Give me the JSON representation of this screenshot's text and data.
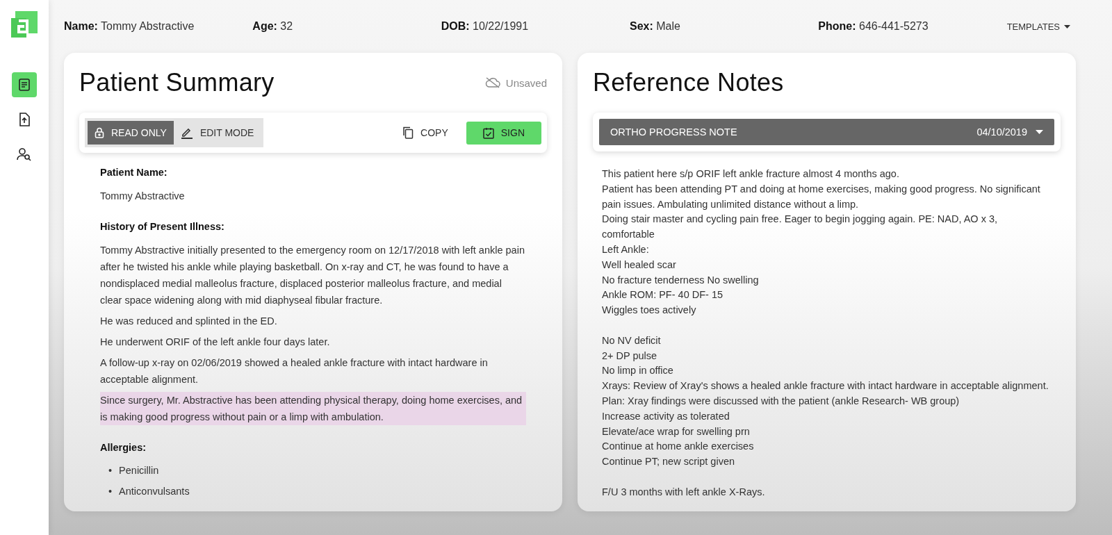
{
  "sidebar": {
    "items": [
      {
        "kind": "document",
        "selected": true
      },
      {
        "kind": "upload",
        "selected": false
      },
      {
        "kind": "user-search",
        "selected": false
      }
    ]
  },
  "header": {
    "fields": [
      "**Name:** Tommy Abstractive",
      "**Age:** 32",
      "**DOB:** 10/22/1991",
      "**Sex:** Male",
      "**Phone:** 646-441-5273"
    ],
    "templates_button": "TEMPLATES"
  },
  "patient_summary": {
    "title": "Patient Summary",
    "save_status": "Unsaved",
    "modes": [
      {
        "label": "READ ONLY",
        "kind": "lock",
        "selected": true
      },
      {
        "label": "EDIT MODE",
        "kind": "pen",
        "selected": false
      }
    ],
    "copy_button": "COPY",
    "sign_button": "SIGN",
    "sections": [
      {
        "heading": "Patient Name:",
        "paragraphs": [
          {
            "text": "Tommy Abstractive",
            "highlighted": false
          }
        ]
      },
      {
        "heading": "History of Present Illness:",
        "paragraphs": [
          {
            "text": "Tommy Abstractive initially presented to the emergency room on 12/17/2018 with left ankle pain after he twisted his ankle while playing basketball. On x-ray and CT, he was found to have a nondisplaced medial malleolus fracture, displaced posterior malleolus fracture, and medial clear space widening along with mid diaphyseal fibular fracture.",
            "highlighted": false
          },
          {
            "text": "He was reduced and splinted in the ED.",
            "highlighted": false
          },
          {
            "text": "He underwent ORIF of the left ankle four days later.",
            "highlighted": false
          },
          {
            "text": "A follow-up x-ray on 02/06/2019 showed a healed ankle fracture with intact hardware in acceptable alignment.",
            "highlighted": false
          },
          {
            "text": "Since surgery, Mr. Abstractive has been attending physical therapy, doing home exercises, and is making good progress without pain or a limp with ambulation.",
            "highlighted": true
          }
        ]
      },
      {
        "heading": "Allergies:",
        "bullets": [
          {
            "marker": "•",
            "text": "Penicillin"
          },
          {
            "marker": "•",
            "text": "Anticonvulsants"
          }
        ]
      }
    ]
  },
  "reference_notes": {
    "title": "Reference Notes",
    "note_select": {
      "label": "ORTHO PROGRESS NOTE",
      "date": "04/10/2019"
    },
    "groups": [
      {
        "lines": [
          "This patient here s/p ORIF left ankle fracture almost 4 months ago.",
          "Patient has been attending PT and doing at home exercises, making good progress. No significant pain issues. Ambulating unlimited distance without a limp.",
          "Doing stair master and cycling pain free. Eager to begin jogging again. PE: NAD, AO x 3, comfortable",
          "Left Ankle:",
          "Well healed scar",
          "No fracture tenderness No swelling",
          "Ankle ROM: PF- 40 DF- 15",
          "Wiggles toes actively"
        ]
      },
      {
        "lines": [
          "No NV deficit",
          "2+ DP pulse",
          "No limp in office",
          "Xrays: Review of Xray's shows a healed ankle fracture with intact hardware in acceptable alignment. Plan: Xray findings were discussed with the patient (ankle Research- WB group)",
          "Increase activity as tolerated",
          "Elevate/ace wrap for swelling prn",
          "Continue at home ankle exercises",
          "Continue PT; new script given"
        ]
      },
      {
        "lines": [
          "F/U 3 months with left ankle X-Rays."
        ]
      }
    ]
  }
}
